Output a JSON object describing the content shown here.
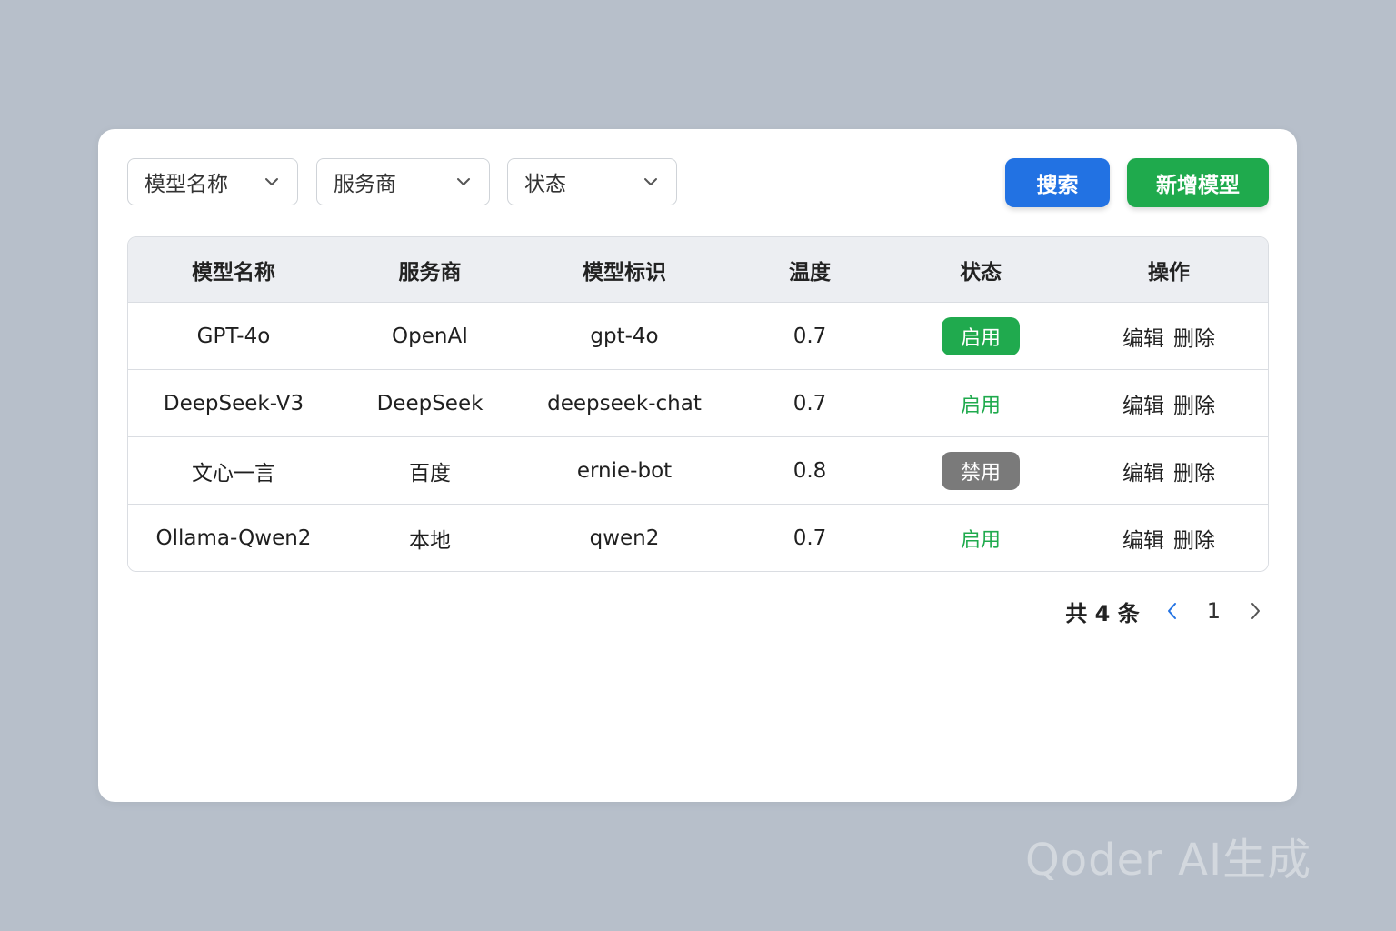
{
  "filters": {
    "model_name": "模型名称",
    "provider": "服务商",
    "status": "状态"
  },
  "buttons": {
    "search": "搜索",
    "add_model": "新增模型"
  },
  "table": {
    "headers": [
      "模型名称",
      "服务商",
      "模型标识",
      "温度",
      "状态",
      "操作"
    ],
    "rows": [
      {
        "name": "GPT-4o",
        "provider": "OpenAI",
        "id": "gpt-4o",
        "temperature": "0.7",
        "status": "启用",
        "status_style": "green-filled",
        "edit": "编辑",
        "delete": "删除"
      },
      {
        "name": "DeepSeek-V3",
        "provider": "DeepSeek",
        "id": "deepseek-chat",
        "temperature": "0.7",
        "status": "启用",
        "status_style": "green-text",
        "edit": "编辑",
        "delete": "删除"
      },
      {
        "name": "文心一言",
        "provider": "百度",
        "id": "ernie-bot",
        "temperature": "0.8",
        "status": "禁用",
        "status_style": "gray-filled",
        "edit": "编辑",
        "delete": "删除"
      },
      {
        "name": "Ollama-Qwen2",
        "provider": "本地",
        "id": "qwen2",
        "temperature": "0.7",
        "status": "启用",
        "status_style": "green-text",
        "edit": "编辑",
        "delete": "删除"
      }
    ]
  },
  "pagination": {
    "total": "共 4 条",
    "current_page": "1"
  },
  "watermark": "Qoder AI生成",
  "colors": {
    "primary": "#2272e3",
    "success": "#1faa4d",
    "disabled": "#7a7a7a",
    "background": "#b7bfca"
  }
}
